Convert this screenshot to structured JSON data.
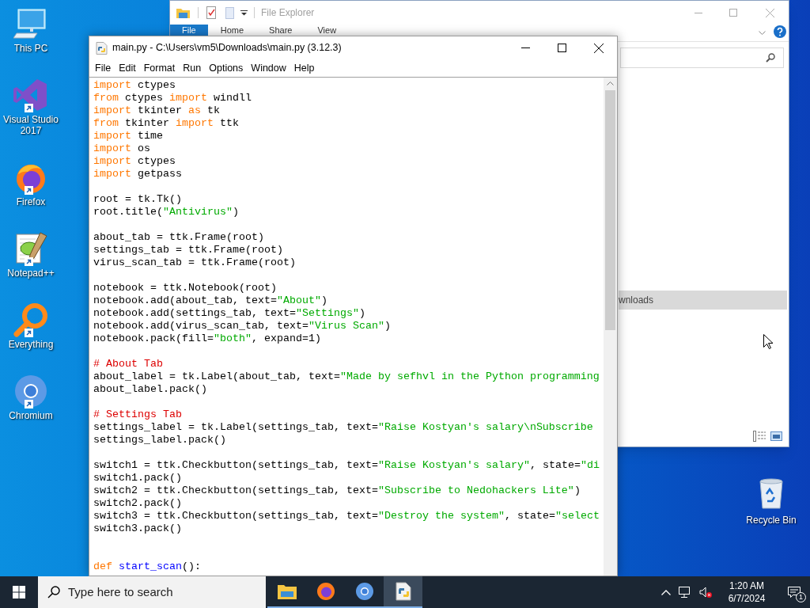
{
  "desktop_icons": [
    {
      "kind": "pc",
      "label": "This PC",
      "shortcut": false
    },
    {
      "kind": "vs",
      "label": "Visual Studio 2017",
      "shortcut": true
    },
    {
      "kind": "firefox",
      "label": "Firefox",
      "shortcut": true
    },
    {
      "kind": "notepadpp",
      "label": "Notepad++",
      "shortcut": true
    },
    {
      "kind": "everything",
      "label": "Everything",
      "shortcut": true
    },
    {
      "kind": "chromium",
      "label": "Chromium",
      "shortcut": true
    }
  ],
  "recycle_bin": {
    "label": "Recycle Bin"
  },
  "explorer": {
    "title": "File Explorer",
    "ribbon_tabs": [
      {
        "label": "File",
        "selected": true
      },
      {
        "label": "Home",
        "selected": false
      },
      {
        "label": "Share",
        "selected": false
      },
      {
        "label": "View",
        "selected": false
      }
    ],
    "nav_item": {
      "label": "wnloads",
      "selected": true
    }
  },
  "editor": {
    "title": "main.py - C:\\Users\\vm5\\Downloads\\main.py (3.12.3)",
    "menu": [
      "File",
      "Edit",
      "Format",
      "Run",
      "Options",
      "Window",
      "Help"
    ],
    "lines": [
      {
        "kind": "code",
        "tokens": [
          {
            "kind": "kw",
            "text": "import"
          },
          {
            "kind": "plain",
            "text": " ctypes"
          }
        ]
      },
      {
        "kind": "code",
        "tokens": [
          {
            "kind": "kw",
            "text": "from"
          },
          {
            "kind": "plain",
            "text": " ctypes "
          },
          {
            "kind": "kw",
            "text": "import"
          },
          {
            "kind": "plain",
            "text": " windll"
          }
        ]
      },
      {
        "kind": "code",
        "tokens": [
          {
            "kind": "kw",
            "text": "import"
          },
          {
            "kind": "plain",
            "text": " tkinter "
          },
          {
            "kind": "kw",
            "text": "as"
          },
          {
            "kind": "plain",
            "text": " tk"
          }
        ]
      },
      {
        "kind": "code",
        "tokens": [
          {
            "kind": "kw",
            "text": "from"
          },
          {
            "kind": "plain",
            "text": " tkinter "
          },
          {
            "kind": "kw",
            "text": "import"
          },
          {
            "kind": "plain",
            "text": " ttk"
          }
        ]
      },
      {
        "kind": "code",
        "tokens": [
          {
            "kind": "kw",
            "text": "import"
          },
          {
            "kind": "plain",
            "text": " time"
          }
        ]
      },
      {
        "kind": "code",
        "tokens": [
          {
            "kind": "kw",
            "text": "import"
          },
          {
            "kind": "plain",
            "text": " os"
          }
        ]
      },
      {
        "kind": "code",
        "tokens": [
          {
            "kind": "kw",
            "text": "import"
          },
          {
            "kind": "plain",
            "text": " ctypes"
          }
        ]
      },
      {
        "kind": "code",
        "tokens": [
          {
            "kind": "kw",
            "text": "import"
          },
          {
            "kind": "plain",
            "text": " getpass"
          }
        ]
      },
      {
        "kind": "blank"
      },
      {
        "kind": "code",
        "tokens": [
          {
            "kind": "plain",
            "text": "root = tk.Tk()"
          }
        ]
      },
      {
        "kind": "code",
        "tokens": [
          {
            "kind": "plain",
            "text": "root.title("
          },
          {
            "kind": "str",
            "text": "\"Antivirus\""
          },
          {
            "kind": "plain",
            "text": ")"
          }
        ]
      },
      {
        "kind": "blank"
      },
      {
        "kind": "code",
        "tokens": [
          {
            "kind": "plain",
            "text": "about_tab = ttk.Frame(root)"
          }
        ]
      },
      {
        "kind": "code",
        "tokens": [
          {
            "kind": "plain",
            "text": "settings_tab = ttk.Frame(root)"
          }
        ]
      },
      {
        "kind": "code",
        "tokens": [
          {
            "kind": "plain",
            "text": "virus_scan_tab = ttk.Frame(root)"
          }
        ]
      },
      {
        "kind": "blank"
      },
      {
        "kind": "code",
        "tokens": [
          {
            "kind": "plain",
            "text": "notebook = ttk.Notebook(root)"
          }
        ]
      },
      {
        "kind": "code",
        "tokens": [
          {
            "kind": "plain",
            "text": "notebook.add(about_tab, text="
          },
          {
            "kind": "str",
            "text": "\"About\""
          },
          {
            "kind": "plain",
            "text": ")"
          }
        ]
      },
      {
        "kind": "code",
        "tokens": [
          {
            "kind": "plain",
            "text": "notebook.add(settings_tab, text="
          },
          {
            "kind": "str",
            "text": "\"Settings\""
          },
          {
            "kind": "plain",
            "text": ")"
          }
        ]
      },
      {
        "kind": "code",
        "tokens": [
          {
            "kind": "plain",
            "text": "notebook.add(virus_scan_tab, text="
          },
          {
            "kind": "str",
            "text": "\"Virus Scan\""
          },
          {
            "kind": "plain",
            "text": ")"
          }
        ]
      },
      {
        "kind": "code",
        "tokens": [
          {
            "kind": "plain",
            "text": "notebook.pack(fill="
          },
          {
            "kind": "str",
            "text": "\"both\""
          },
          {
            "kind": "plain",
            "text": ", expand=1)"
          }
        ]
      },
      {
        "kind": "blank"
      },
      {
        "kind": "code",
        "tokens": [
          {
            "kind": "comment",
            "text": "# About Tab"
          }
        ]
      },
      {
        "kind": "code",
        "tokens": [
          {
            "kind": "plain",
            "text": "about_label = tk.Label(about_tab, text="
          },
          {
            "kind": "str",
            "text": "\"Made by sefhvl in the Python programming"
          }
        ]
      },
      {
        "kind": "code",
        "tokens": [
          {
            "kind": "plain",
            "text": "about_label.pack()"
          }
        ]
      },
      {
        "kind": "blank"
      },
      {
        "kind": "code",
        "tokens": [
          {
            "kind": "comment",
            "text": "# Settings Tab"
          }
        ]
      },
      {
        "kind": "code",
        "tokens": [
          {
            "kind": "plain",
            "text": "settings_label = tk.Label(settings_tab, text="
          },
          {
            "kind": "str",
            "text": "\"Raise Kostyan's salary\\nSubscribe"
          }
        ]
      },
      {
        "kind": "code",
        "tokens": [
          {
            "kind": "plain",
            "text": "settings_label.pack()"
          }
        ]
      },
      {
        "kind": "blank"
      },
      {
        "kind": "code",
        "tokens": [
          {
            "kind": "plain",
            "text": "switch1 = ttk.Checkbutton(settings_tab, text="
          },
          {
            "kind": "str",
            "text": "\"Raise Kostyan's salary\""
          },
          {
            "kind": "plain",
            "text": ", state="
          },
          {
            "kind": "str",
            "text": "\"di"
          }
        ]
      },
      {
        "kind": "code",
        "tokens": [
          {
            "kind": "plain",
            "text": "switch1.pack()"
          }
        ]
      },
      {
        "kind": "code",
        "tokens": [
          {
            "kind": "plain",
            "text": "switch2 = ttk.Checkbutton(settings_tab, text="
          },
          {
            "kind": "str",
            "text": "\"Subscribe to Nedohackers Lite\""
          },
          {
            "kind": "plain",
            "text": ")"
          }
        ]
      },
      {
        "kind": "code",
        "tokens": [
          {
            "kind": "plain",
            "text": "switch2.pack()"
          }
        ]
      },
      {
        "kind": "code",
        "tokens": [
          {
            "kind": "plain",
            "text": "switch3 = ttk.Checkbutton(settings_tab, text="
          },
          {
            "kind": "str",
            "text": "\"Destroy the system\""
          },
          {
            "kind": "plain",
            "text": ", state="
          },
          {
            "kind": "str",
            "text": "\"select"
          }
        ]
      },
      {
        "kind": "code",
        "tokens": [
          {
            "kind": "plain",
            "text": "switch3.pack()"
          }
        ]
      },
      {
        "kind": "blank"
      },
      {
        "kind": "blank"
      },
      {
        "kind": "code",
        "tokens": [
          {
            "kind": "kw",
            "text": "def"
          },
          {
            "kind": "defname",
            "text": " start_scan"
          },
          {
            "kind": "plain",
            "text": "():"
          }
        ]
      }
    ]
  },
  "taskbar": {
    "search_placeholder": "Type here to search",
    "apps": [
      {
        "kind": "explorer",
        "active": false
      },
      {
        "kind": "firefox",
        "active": false
      },
      {
        "kind": "chromium",
        "active": false
      },
      {
        "kind": "python",
        "active": true
      }
    ],
    "time": "1:20 AM",
    "date": "6/7/2024",
    "notification_count": "1"
  }
}
